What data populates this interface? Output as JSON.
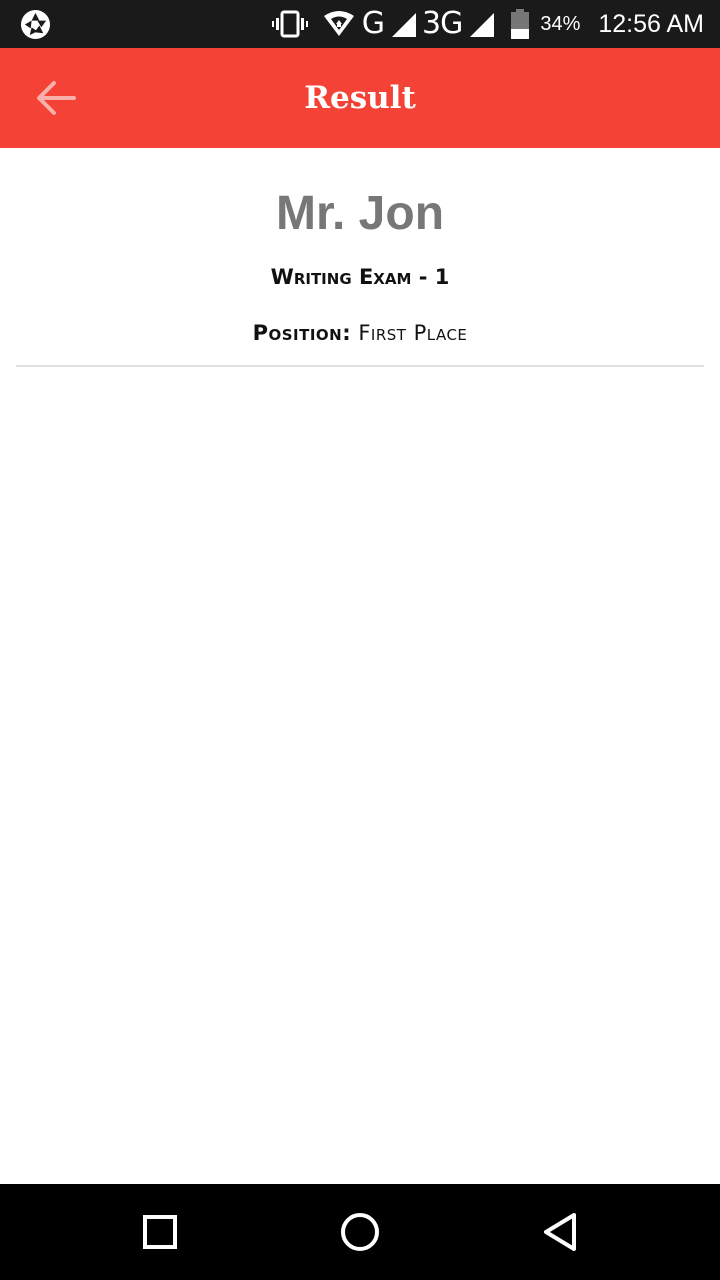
{
  "status_bar": {
    "network_g": "G",
    "network_3g": "3G",
    "battery_percent": "34%",
    "time": "12:56 AM",
    "icons": [
      "aperture-icon",
      "vibrate-icon",
      "wifi-icon",
      "signal-icon",
      "battery-icon"
    ]
  },
  "app_bar": {
    "title": "Result",
    "background_color": "#f44336",
    "back_icon": "arrow-left-icon"
  },
  "result": {
    "student_name": "Mr. Jon",
    "exam_title": "Writing Exam - 1",
    "position_label": "Position:",
    "position_value": "First Place"
  },
  "nav_bar": {
    "icons": [
      "recents-square-icon",
      "home-circle-icon",
      "back-triangle-icon"
    ]
  }
}
